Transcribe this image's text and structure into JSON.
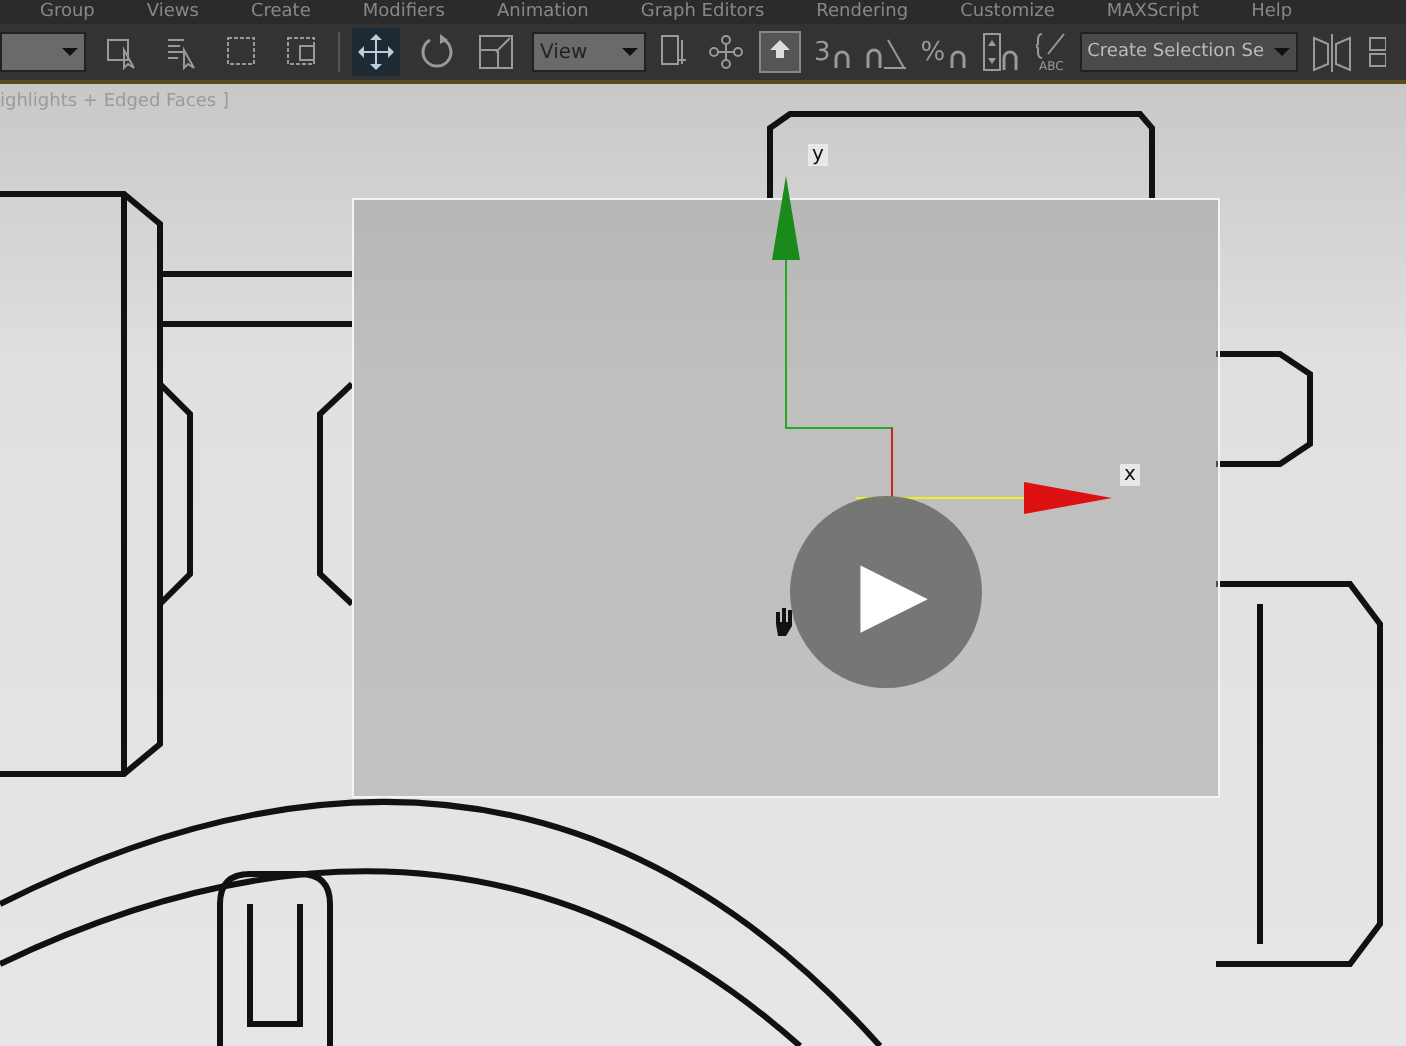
{
  "menu": [
    "Group",
    "Views",
    "Create",
    "Modifiers",
    "Animation",
    "Graph Editors",
    "Rendering",
    "Customize",
    "MAXScript",
    "Help"
  ],
  "toolbar": {
    "reference_coord": "View",
    "snap_glyph": "3",
    "percent_glyph": "%",
    "named_set_glyph": "ABC",
    "named_selection": "Create Selection Se"
  },
  "tools": [
    {
      "kind": "select-object",
      "selected": false
    },
    {
      "kind": "select-by-name",
      "selected": false
    },
    {
      "kind": "rect-region",
      "selected": false
    },
    {
      "kind": "window-crossing",
      "selected": false
    },
    {
      "kind": "move",
      "selected": true
    },
    {
      "kind": "rotate",
      "selected": false
    },
    {
      "kind": "scale",
      "selected": false
    }
  ],
  "viewport": {
    "label": "ighlights + Edged Faces ]",
    "axis_y": "y",
    "axis_x": "x"
  },
  "player": {
    "play_glyph": "▶"
  }
}
